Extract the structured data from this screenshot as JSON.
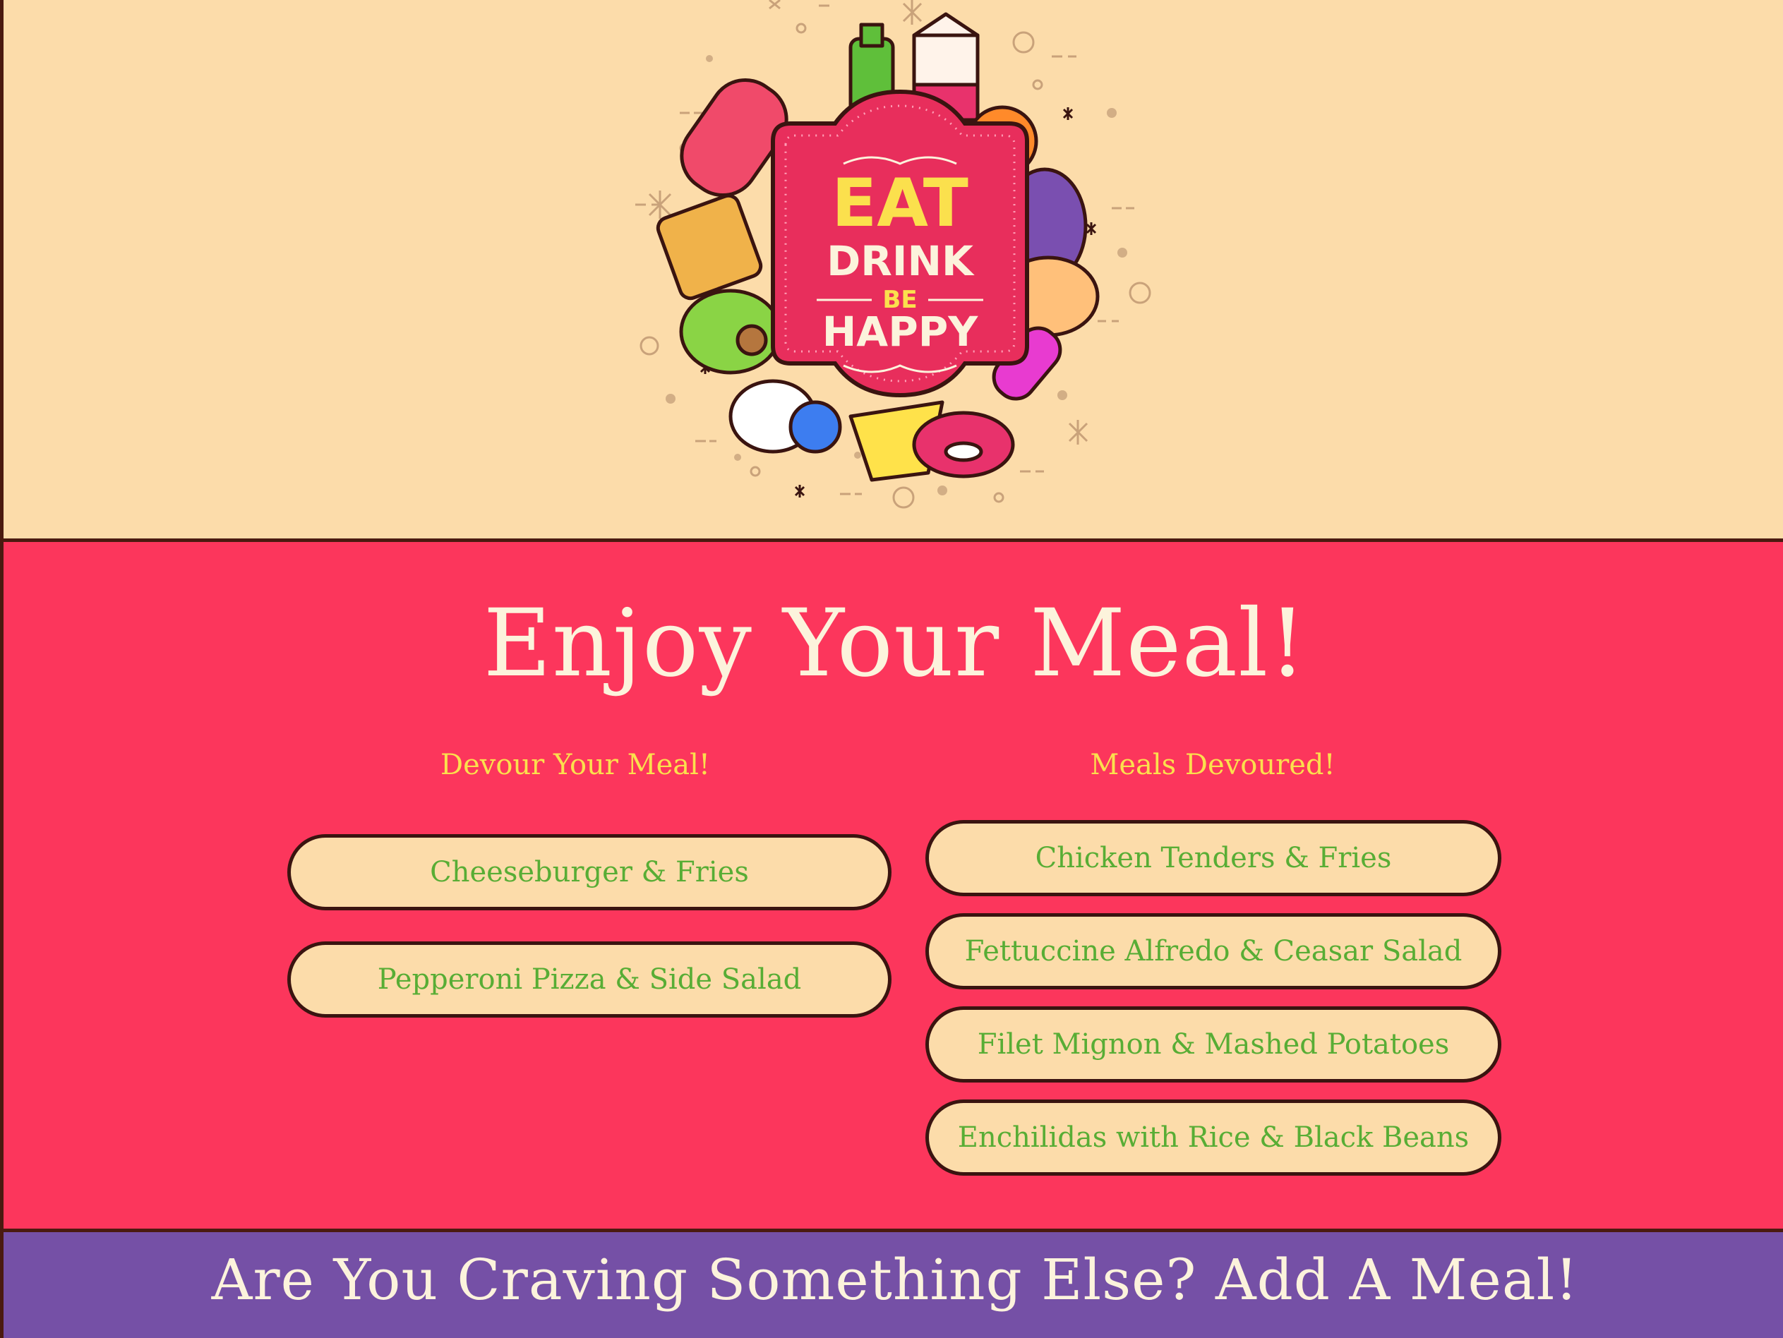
{
  "logo": {
    "line1": "EAT",
    "line2": "DRINK",
    "line3": "BE",
    "line4": "HAPPY"
  },
  "main": {
    "title": "Enjoy Your Meal!",
    "devour_heading": "Devour Your Meal!",
    "devoured_heading": "Meals Devoured!",
    "to_devour": [
      "Cheeseburger & Fries",
      "Pepperoni Pizza & Side Salad"
    ],
    "devoured": [
      "Chicken Tenders & Fries",
      "Fettuccine Alfredo & Ceasar Salad",
      "Filet Mignon & Mashed Potatoes",
      "Enchilidas with Rice & Black Beans"
    ]
  },
  "footer": {
    "title": "Are You Craving Something Else? Add A Meal!"
  },
  "colors": {
    "cream": "#fcdcaa",
    "red": "#fc365c",
    "purple": "#7550a6",
    "green_text": "#58ad35",
    "yellow_text": "#fbe04d",
    "border": "#4a1a10"
  }
}
